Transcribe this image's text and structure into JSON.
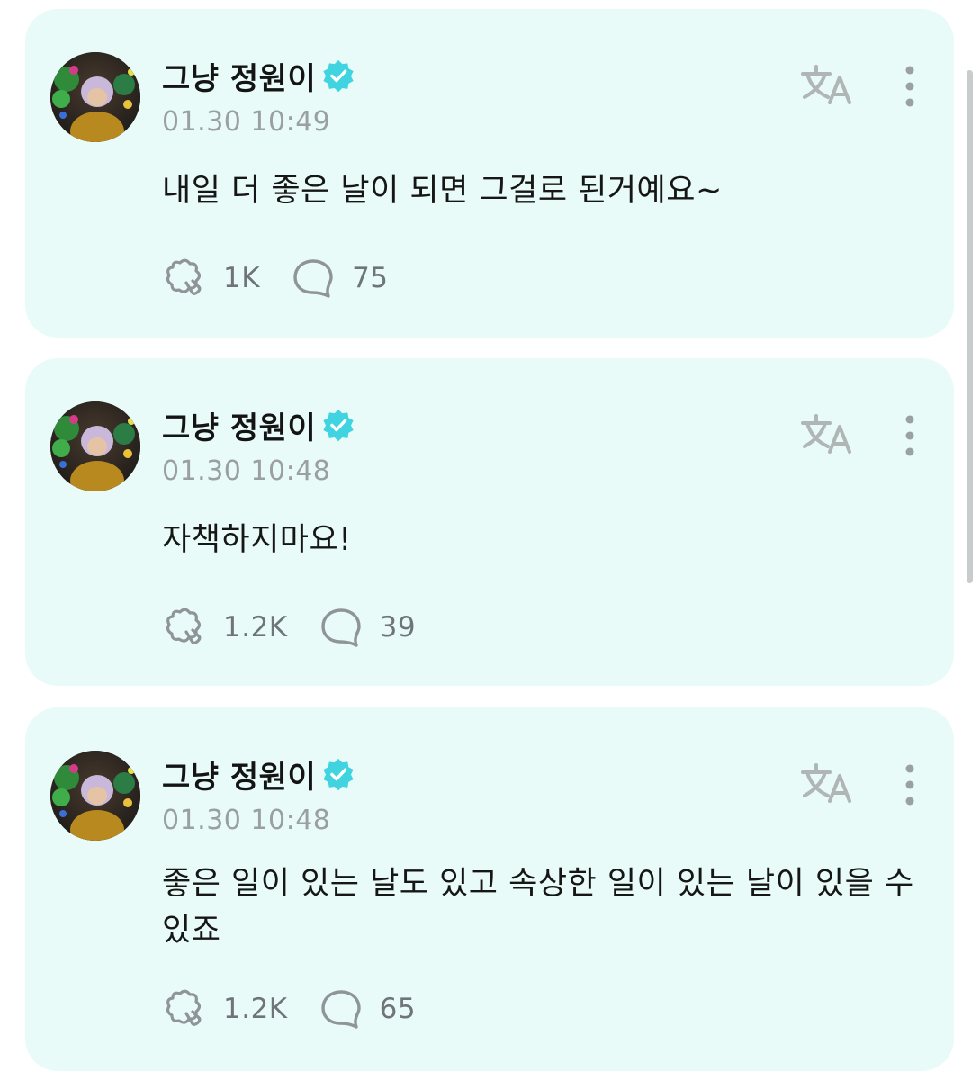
{
  "posts": [
    {
      "author": "그냥 정원이",
      "timestamp": "01.30 10:49",
      "text": "내일 더 좋은 날이 되면 그걸로 된거예요~",
      "likes": "1K",
      "comments": "75"
    },
    {
      "author": "그냥 정원이",
      "timestamp": "01.30 10:48",
      "text": "자책하지마요!",
      "likes": "1.2K",
      "comments": "39"
    },
    {
      "author": "그냥 정원이",
      "timestamp": "01.30 10:48",
      "text": "좋은 일이 있는 날도 있고 속상한 일이 있는 날이 있을 수 있죠",
      "likes": "1.2K",
      "comments": "65"
    }
  ],
  "icons": {
    "verified": "verified-badge-icon",
    "translate": "translate-icon",
    "more": "more-vertical-icon",
    "like": "like-icon",
    "comment": "comment-icon"
  },
  "colors": {
    "card_background": "#e8fbf8",
    "verified": "#3fd4e0",
    "icon_gray": "#8e9497",
    "translate_icon": "#b0b5b5"
  }
}
